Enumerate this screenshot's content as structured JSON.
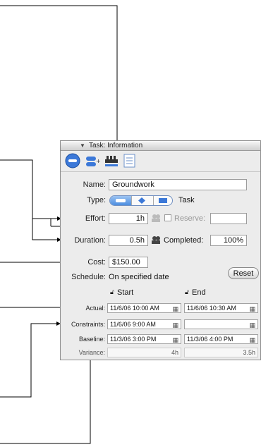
{
  "panel": {
    "title": "Task: Information",
    "toolbar_icons": [
      "task-info-icon",
      "resources-icon",
      "dependencies-icon",
      "notes-icon"
    ]
  },
  "form": {
    "name_label": "Name:",
    "name_value": "Groundwork",
    "type_label": "Type:",
    "type_value": "Task",
    "effort_label": "Effort:",
    "effort_value": "1h",
    "reserve_label": "Reserve:",
    "duration_label": "Duration:",
    "duration_value": "0.5h",
    "completed_label": "Completed:",
    "completed_value": "100%",
    "cost_label": "Cost:",
    "cost_value": "$150.00",
    "schedule_label": "Schedule:",
    "schedule_value": "On specified date",
    "reset_label": "Reset"
  },
  "dates": {
    "start_header": "Start",
    "end_header": "End",
    "rows": [
      {
        "label": "Actual:",
        "start": "11/6/06 10:00 AM",
        "end": "11/6/06 10:30 AM"
      },
      {
        "label": "Constraints:",
        "start": "11/6/06 9:00 AM",
        "end": ""
      },
      {
        "label": "Baseline:",
        "start": "11/3/06 3:00 PM",
        "end": "11/3/06 4:00 PM"
      },
      {
        "label": "Variance:",
        "start": "4h",
        "end": "3.5h"
      }
    ]
  }
}
